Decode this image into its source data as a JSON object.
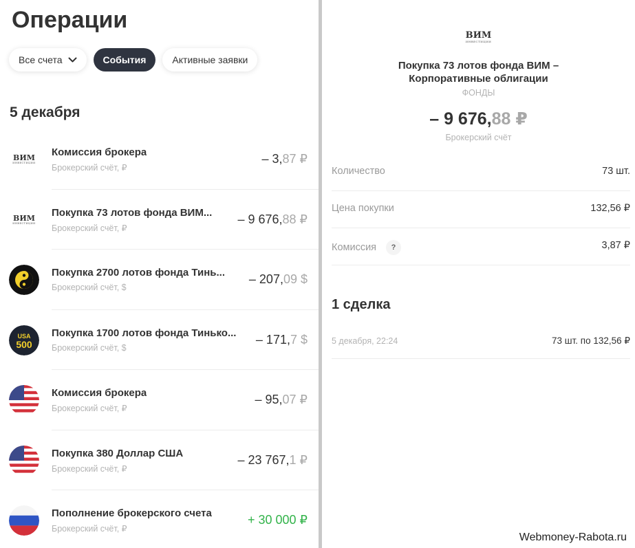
{
  "header": {
    "title": "Операции"
  },
  "filters": [
    {
      "label": "Все счета",
      "active": false,
      "has_dropdown": true
    },
    {
      "label": "События",
      "active": true
    },
    {
      "label": "Активные заявки",
      "active": false
    }
  ],
  "date_group": "5 декабря",
  "operations": [
    {
      "icon": "vim-logo",
      "title": "Комиссия брокера",
      "account": "Брокерский счёт, ₽",
      "amount_main": "– 3,",
      "amount_frac": "87 ₽",
      "positive": false
    },
    {
      "icon": "vim-logo",
      "title": "Покупка 73 лотов фонда ВИМ...",
      "account": "Брокерский счёт, ₽",
      "amount_main": "– 9 676,",
      "amount_frac": "88 ₽",
      "positive": false
    },
    {
      "icon": "yin-yang-icon",
      "title": "Покупка 2700 лотов фонда Тинь...",
      "account": "Брокерский счёт, $",
      "amount_main": "– 207,",
      "amount_frac": "09 $",
      "positive": false
    },
    {
      "icon": "usa-500-icon",
      "title": "Покупка 1700 лотов фонда Тинько...",
      "account": "Брокерский счёт, $",
      "amount_main": "– 171,",
      "amount_frac": "7 $",
      "positive": false
    },
    {
      "icon": "us-flag-icon",
      "title": "Комиссия брокера",
      "account": "Брокерский счёт, ₽",
      "amount_main": "– 95,",
      "amount_frac": "07 ₽",
      "positive": false
    },
    {
      "icon": "us-flag-icon",
      "title": "Покупка 380 Доллар США",
      "account": "Брокерский счёт, ₽",
      "amount_main": "– 23 767,",
      "amount_frac": "1 ₽",
      "positive": false
    },
    {
      "icon": "russia-flag-icon",
      "title": "Пополнение брокерского счета",
      "account": "Брокерский счёт, ₽",
      "amount_main": "+ 30 000 ₽",
      "amount_frac": "",
      "positive": true
    }
  ],
  "logo": {
    "text": "ВИМ",
    "subtext": "ИНВЕСТИЦИИ"
  },
  "detail": {
    "title": "Покупка 73 лотов фонда ВИМ – Корпоративные облигации",
    "category": "ФОНДЫ",
    "amount_main": "– 9 676,",
    "amount_frac": "88 ₽",
    "account": "Брокерский счёт",
    "rows": [
      {
        "label": "Количество",
        "value": "73 шт."
      },
      {
        "label": "Цена покупки",
        "value": "132,56 ₽"
      },
      {
        "label": "Комиссия",
        "value": "3,87 ₽",
        "help": "?"
      }
    ],
    "deals_heading": "1 сделка",
    "deal": {
      "date": "5 декабря, 22:24",
      "value": "73 шт. по 132,56 ₽"
    }
  },
  "watermark": "Webmoney-Rabota.ru"
}
